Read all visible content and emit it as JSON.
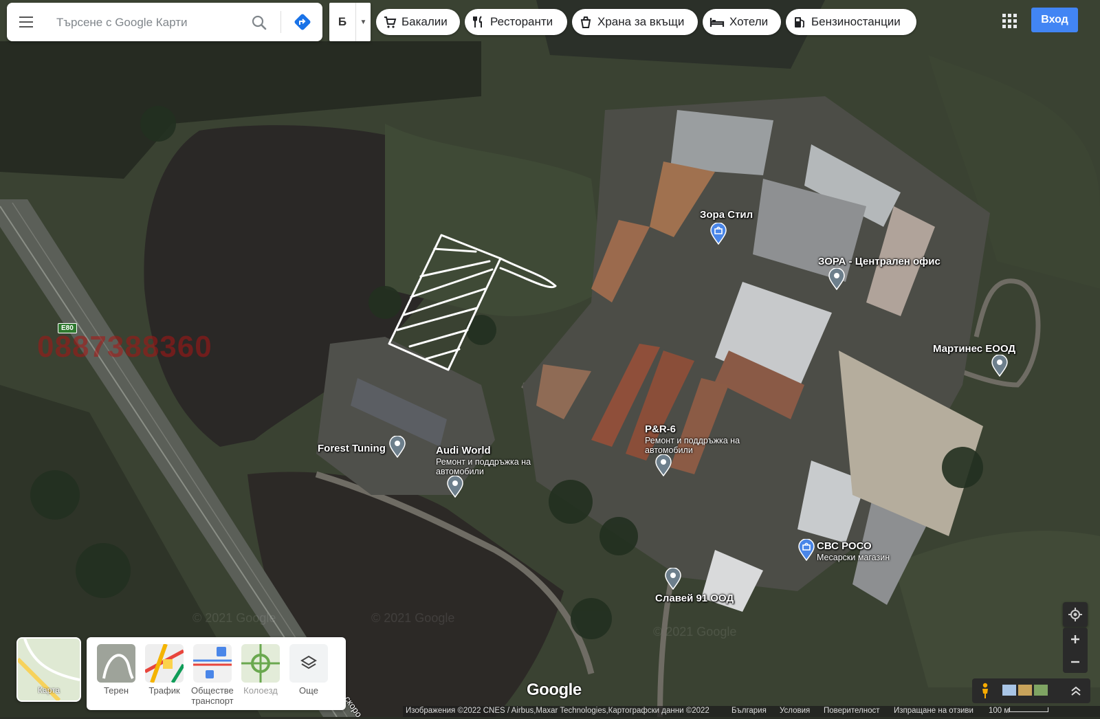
{
  "search": {
    "placeholder": "Търсене с Google Карти"
  },
  "language_button": "Б",
  "chips": [
    {
      "label": "Бакалии",
      "icon": "cart-icon"
    },
    {
      "label": "Ресторанти",
      "icon": "restaurant-icon"
    },
    {
      "label": "Храна за вкъщи",
      "icon": "takeout-icon"
    },
    {
      "label": "Хотели",
      "icon": "hotel-icon"
    },
    {
      "label": "Бензиностанции",
      "icon": "gas-station-icon"
    }
  ],
  "sign_in": "Вход",
  "phone_watermark": "0887388360",
  "road_badge": "E80",
  "road_name": "на скоро",
  "watermark": "© 2021 Google",
  "places": [
    {
      "name": "Зора Стил",
      "subtitle": "",
      "type": "shopping"
    },
    {
      "name": "ЗОРА - Централен офис",
      "subtitle": "",
      "type": "generic"
    },
    {
      "name": "Мартинес ЕООД",
      "subtitle": "",
      "type": "generic"
    },
    {
      "name": "Forest Tuning",
      "subtitle": "",
      "type": "generic"
    },
    {
      "name": "Audi World",
      "subtitle": "Ремонт и поддръжка на автомобили",
      "type": "generic"
    },
    {
      "name": "P&R-6",
      "subtitle": "Ремонт и поддръжка на автомобили",
      "type": "generic"
    },
    {
      "name": "СВС РОСО",
      "subtitle": "Месарски магазин",
      "type": "shopping"
    },
    {
      "name": "Славей 91 ООД",
      "subtitle": "",
      "type": "generic"
    }
  ],
  "map_type": {
    "label": "Карта"
  },
  "layers": [
    {
      "label": "Терен"
    },
    {
      "label": "Трафик"
    },
    {
      "label": "Обществен транспорт"
    },
    {
      "label": "Колоезд"
    },
    {
      "label": "Още"
    }
  ],
  "logo": "Google",
  "footer": {
    "imagery": "Изображения ©2022 CNES / Airbus,Maxar Technologies,Картографски данни ©2022",
    "country": "България",
    "terms": "Условия",
    "privacy": "Поверителност",
    "feedback": "Изпращане на отзиви",
    "scale": "100 м"
  },
  "colors": {
    "pin": "#6d7f8c",
    "pin_shopping": "#4a86e8",
    "accent": "#4285f4"
  }
}
